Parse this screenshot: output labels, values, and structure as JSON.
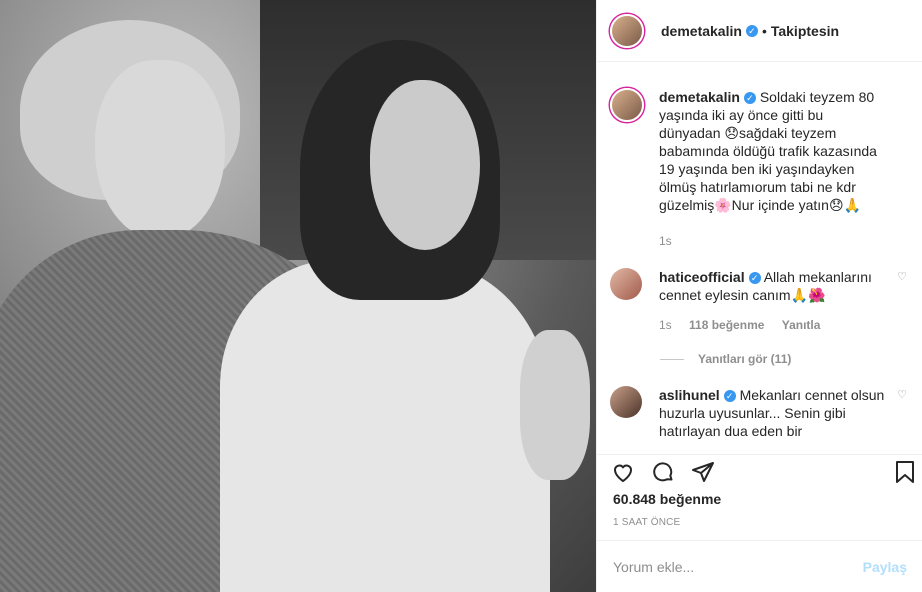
{
  "post": {
    "author": "demetakalin",
    "follow_status": "Takiptesin",
    "dot": "•"
  },
  "caption": {
    "user": "demetakalin",
    "text": "Soldaki teyzem 80 yaşında iki ay önce gitti bu dünyadan 😞sağdaki teyzem babamında öldüğü trafik kazasında 19 yaşında ben iki yaşındayken ölmüş hatırlamıorum tabi ne kdr güzelmiş🌸Nur içinde yatın😞🙏",
    "time": "1s"
  },
  "comments": [
    {
      "user": "haticeofficial",
      "text": "Allah mekanlarını cennet eylesin canım🙏🌺",
      "time": "1s",
      "likes": "118 beğenme",
      "reply": "Yanıtla",
      "view_replies": "Yanıtları gör (11)"
    },
    {
      "user": "aslihunel",
      "text": "Mekanları cennet olsun huzurla uyusunlar... Senin gibi hatırlayan dua eden bir"
    }
  ],
  "likes_count": "60.848 beğenme",
  "posted_ago": "1 SAAT ÖNCE",
  "add_comment": {
    "placeholder": "Yorum ekle...",
    "post_label": "Paylaş"
  },
  "icons": {
    "verified": "verified-badge-icon",
    "like": "heart-icon",
    "comment": "comment-icon",
    "share": "share-icon",
    "save": "bookmark-icon"
  },
  "colors": {
    "verified": "#3897f0",
    "story_ring": "#d6249f",
    "post_disabled": "#b2dffc",
    "muted_text": "#8e8e8e"
  }
}
